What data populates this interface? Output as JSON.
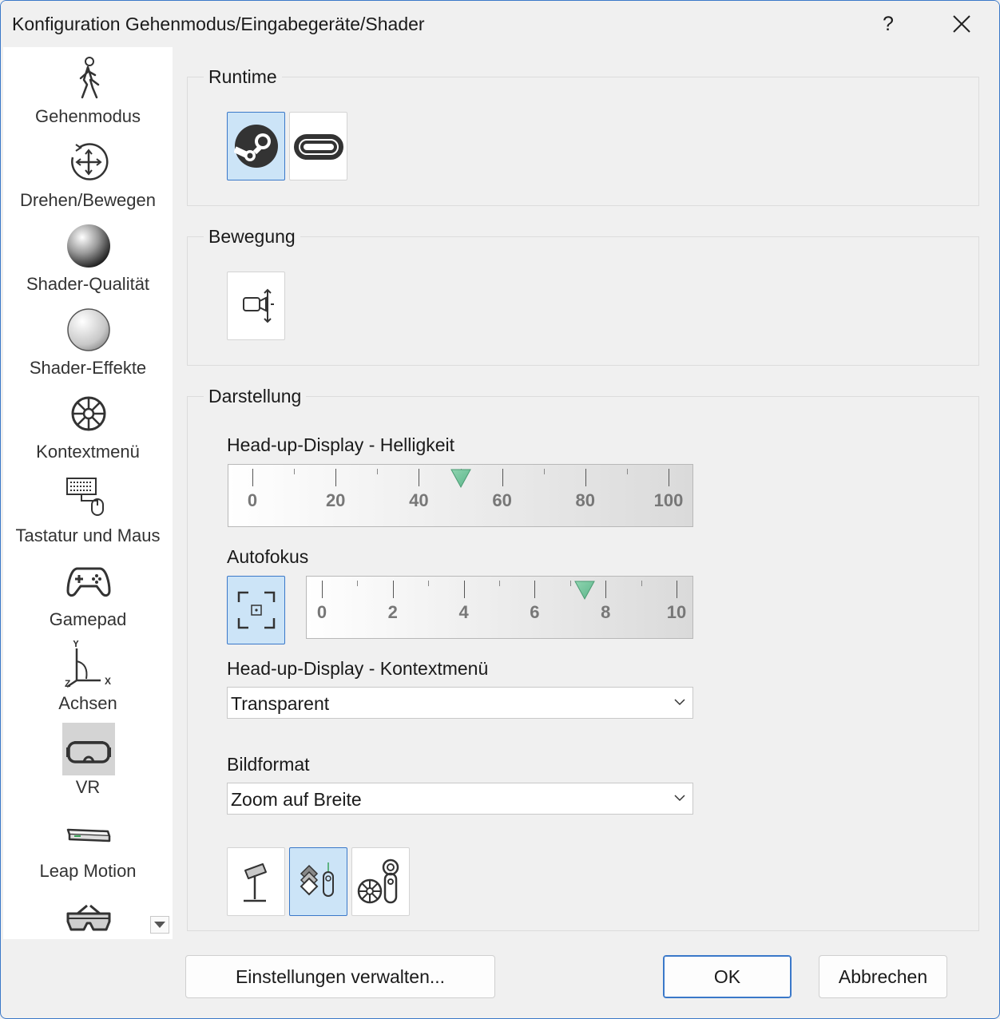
{
  "window": {
    "title": "Konfiguration Gehenmodus/Eingabegeräte/Shader",
    "help_label": "?"
  },
  "sidebar": {
    "items": [
      {
        "label": "Gehenmodus",
        "icon": "walking-person-icon"
      },
      {
        "label": "Drehen/Bewegen",
        "icon": "rotate-move-icon"
      },
      {
        "label": "Shader-Qualität",
        "icon": "shaded-sphere-icon"
      },
      {
        "label": "Shader-Effekte",
        "icon": "sphere-effects-icon"
      },
      {
        "label": "Kontextmenü",
        "icon": "context-wheel-icon"
      },
      {
        "label": "Tastatur und Maus",
        "icon": "keyboard-mouse-icon"
      },
      {
        "label": "Gamepad",
        "icon": "gamepad-icon"
      },
      {
        "label": "Achsen",
        "icon": "axes-icon",
        "axis_letters": [
          "Y",
          "Z",
          "X"
        ]
      },
      {
        "label": "VR",
        "icon": "vr-headset-icon",
        "selected": true
      },
      {
        "label": "Leap Motion",
        "icon": "leap-motion-icon"
      },
      {
        "label": "",
        "icon": "3d-glasses-icon"
      }
    ]
  },
  "runtime": {
    "title": "Runtime",
    "options": [
      {
        "icon": "steamvr-icon",
        "active": true
      },
      {
        "icon": "oculus-icon",
        "active": false
      }
    ]
  },
  "bewegung": {
    "title": "Bewegung",
    "options": [
      {
        "icon": "camera-teleport-icon",
        "active": false
      }
    ]
  },
  "darstellung": {
    "title": "Darstellung",
    "hud_brightness": {
      "label": "Head-up-Display - Helligkeit",
      "min": 0,
      "max": 100,
      "value": 50,
      "tick_labels": [
        "0",
        "20",
        "40",
        "60",
        "80",
        "100"
      ]
    },
    "autofocus": {
      "label": "Autofokus",
      "toggle_active": true,
      "min": 0,
      "max": 10,
      "value": 7.4,
      "tick_labels": [
        "0",
        "2",
        "4",
        "6",
        "8",
        "10"
      ]
    },
    "hud_context": {
      "label": "Head-up-Display - Kontextmenü",
      "value": "Transparent"
    },
    "image_format": {
      "label": "Bildformat",
      "value": "Zoom auf Breite"
    },
    "mode_buttons": [
      {
        "icon": "pedestal-icon",
        "active": false
      },
      {
        "icon": "layers-controller-icon",
        "active": true
      },
      {
        "icon": "wheel-controller-icon",
        "active": false
      }
    ]
  },
  "footer": {
    "manage_label": "Einstellungen verwalten...",
    "ok_label": "OK",
    "cancel_label": "Abbrechen"
  },
  "colors": {
    "accent": "#3a78c9",
    "active_fill": "#cce4f7",
    "slider_thumb": "#5cb58a"
  }
}
